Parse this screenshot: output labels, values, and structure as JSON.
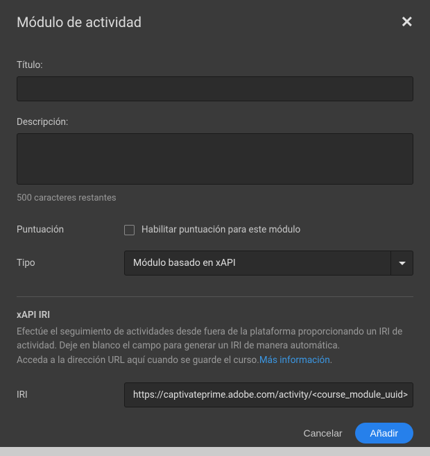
{
  "modal": {
    "title": "Módulo de actividad"
  },
  "fields": {
    "titulo_label": "Título:",
    "titulo_value": "",
    "descripcion_label": "Descripción:",
    "descripcion_value": "",
    "descripcion_helper": "500 caracteres restantes",
    "puntuacion_label": "Puntuación",
    "puntuacion_checkbox_label": "Habilitar puntuación para este módulo",
    "tipo_label": "Tipo",
    "tipo_value": "Módulo basado en xAPI"
  },
  "xapi": {
    "section_title": "xAPI IRI",
    "desc_line1": "Efectúe el seguimiento de actividades desde fuera de la plataforma proporcionando un IRI de actividad. Deje en blanco el campo para generar un IRI de manera automática.",
    "desc_line2_prefix": "Acceda a la dirección URL aquí cuando se guarde el curso.",
    "more_info_link": "Más información",
    "iri_label": "IRI",
    "iri_value": "https://captivateprime.adobe.com/activity/<course_module_uuid>"
  },
  "footer": {
    "cancel": "Cancelar",
    "add": "Añadir"
  }
}
